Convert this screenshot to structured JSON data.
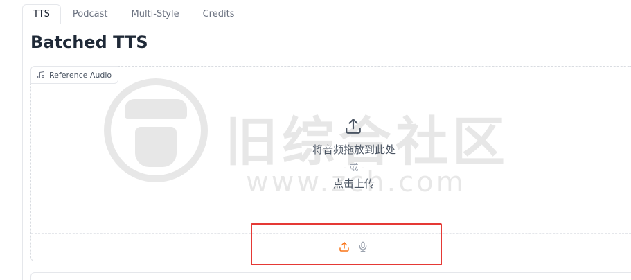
{
  "tabs": [
    {
      "label": "TTS",
      "active": true
    },
    {
      "label": "Podcast",
      "active": false
    },
    {
      "label": "Multi-Style",
      "active": false
    },
    {
      "label": "Credits",
      "active": false
    }
  ],
  "page": {
    "title": "Batched TTS"
  },
  "reference_audio": {
    "label": "Reference Audio",
    "label_icon": "music-note-icon",
    "drop_text": "将音频拖放到此处",
    "or_text": "- 或 -",
    "click_text": "点击上传",
    "upload_icon": "upload-icon",
    "toolbar": {
      "upload_icon": "upload-icon",
      "upload_color": "#f97316",
      "mic_icon": "microphone-icon",
      "mic_color": "#9ca3af"
    }
  },
  "watermark": {
    "title": "旧综合社区",
    "url": "www.zch.com"
  },
  "colors": {
    "accent": "#f97316",
    "highlight": "#e53935",
    "border": "#e5e7eb"
  }
}
